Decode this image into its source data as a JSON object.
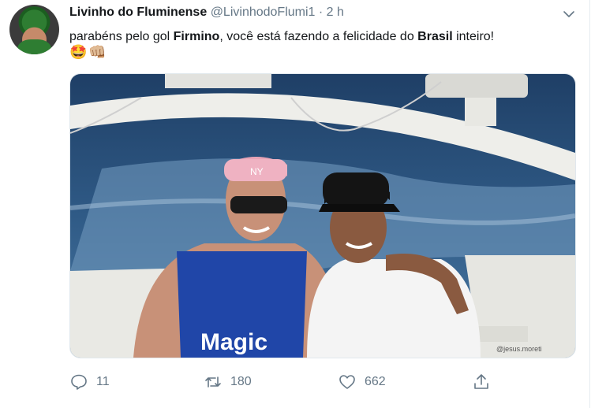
{
  "tweet": {
    "display_name": "Livinho do Fluminense",
    "handle": "@LivinhodoFlumi1",
    "separator": "·",
    "time": "2 h",
    "text_parts": [
      {
        "text": "parabéns pelo gol ",
        "bold": false
      },
      {
        "text": "Firmino",
        "bold": true
      },
      {
        "text": ", você está fazendo a felicidade do ",
        "bold": false
      },
      {
        "text": "Brasil",
        "bold": true
      },
      {
        "text": " inteiro!",
        "bold": false
      }
    ],
    "emojis": "🤩👊🏼",
    "media": {
      "jersey_text": "Magic",
      "cap_text": "NY",
      "watermark": "@jesus.moreti"
    },
    "actions": {
      "reply_count": "11",
      "retweet_count": "180",
      "like_count": "662"
    }
  },
  "colors": {
    "text": "#14171a",
    "secondary": "#657786",
    "border": "#e6ecf0"
  },
  "icons": [
    "chevron-down-icon",
    "reply-icon",
    "retweet-icon",
    "like-icon",
    "share-icon"
  ]
}
